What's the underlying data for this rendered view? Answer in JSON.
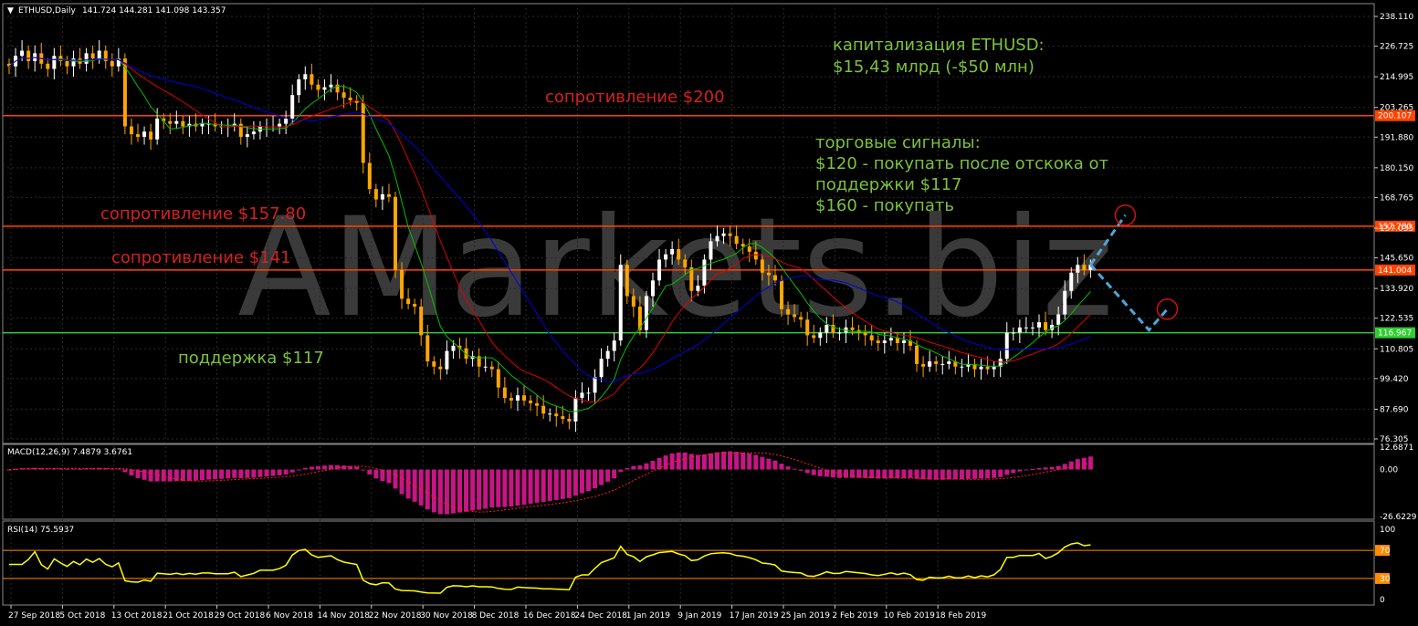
{
  "header": {
    "symbol": "ETHUSD,Daily",
    "ohlc": "141.724 144.281 141.098 143.357"
  },
  "watermark": "AMarkets.biz",
  "colors": {
    "bull": "#ffffff",
    "bear": "#ffa500",
    "grid": "#2a2a2a",
    "ma_fast": "#00c000",
    "ma_mid": "#e00000",
    "ma_slow": "#0000e0",
    "resistance": "#ff4500",
    "support": "#32cd32",
    "macd_hist": "#c71585",
    "macd_signal": "#ff2020",
    "rsi": "#ffff00",
    "rsi_level": "#ff8c00",
    "forecast": "#4ea5d9",
    "target_circle": "#d01010",
    "note_green": "#7cc23c",
    "note_red": "#d42020"
  },
  "annotations": {
    "cap_line1": "капитализация ETHUSD:",
    "cap_line2": "$15,43 млрд (-$50 млн)",
    "signals_line1": "торговые сигналы:",
    "signals_line2": "$120 - покупать после отскока от",
    "signals_line3": "поддержки $117",
    "signals_line4": "$160 - покупать",
    "res200": "сопротивление $200",
    "res157": "сопротивление $157.80",
    "res141": "сопротивление $141",
    "sup117": "поддержка $117"
  },
  "chart_data": [
    {
      "type": "candlestick",
      "name": "ETHUSD,Daily",
      "yticks": [
        "238.110",
        "226.725",
        "214.995",
        "203.265",
        "191.880",
        "180.150",
        "168.765",
        "157.035",
        "145.650",
        "133.920",
        "122.535",
        "110.805",
        "99.420",
        "87.690",
        "76.305"
      ],
      "ylim": [
        76.305,
        238.11
      ],
      "x_labels": [
        "27 Sep 2018",
        "5 Oct 2018",
        "13 Oct 2018",
        "21 Oct 2018",
        "29 Oct 2018",
        "6 Nov 2018",
        "14 Nov 2018",
        "22 Nov 2018",
        "30 Nov 2018",
        "8 Dec 2018",
        "16 Dec 2018",
        "24 Dec 2018",
        "1 Jan 2019",
        "9 Jan 2019",
        "17 Jan 2019",
        "25 Jan 2019",
        "2 Feb 2019",
        "10 Feb 2019",
        "18 Feb 2019"
      ],
      "levels": [
        {
          "value": 200.107,
          "label": "200.107",
          "kind": "resistance"
        },
        {
          "value": 157.78,
          "label": "157.780",
          "kind": "resistance"
        },
        {
          "value": 141.004,
          "label": "141.004",
          "kind": "resistance"
        },
        {
          "value": 116.967,
          "label": "116.967",
          "kind": "support"
        }
      ],
      "close": [
        219,
        223,
        225,
        221,
        224,
        220,
        218,
        223,
        221,
        219,
        222,
        220,
        224,
        222,
        225,
        221,
        219,
        222,
        196,
        193,
        192,
        194,
        191,
        199,
        198,
        197,
        198,
        196,
        197,
        196,
        197,
        197,
        196,
        196,
        196,
        197,
        192,
        193,
        194,
        196,
        196,
        196,
        197,
        199,
        208,
        214,
        216,
        212,
        210,
        211,
        212,
        209,
        207,
        206,
        205,
        182,
        172,
        168,
        170,
        169,
        141,
        130,
        128,
        127,
        116,
        106,
        104,
        103,
        110,
        112,
        111,
        107,
        108,
        104,
        104,
        103,
        96,
        92,
        91,
        93,
        91,
        90,
        89,
        86,
        86,
        85,
        84,
        83,
        92,
        94,
        94,
        100,
        107,
        110,
        114,
        143,
        131,
        127,
        118,
        131,
        137,
        145,
        147,
        149,
        145,
        142,
        133,
        135,
        145,
        152,
        154,
        155,
        154,
        151,
        150,
        148,
        145,
        140,
        139,
        137,
        126,
        124,
        123,
        122,
        116,
        115,
        117,
        120,
        117,
        117,
        119,
        118,
        117,
        116,
        114,
        113,
        114,
        115,
        113,
        114,
        112,
        105,
        104,
        106,
        105,
        105,
        106,
        104,
        104,
        105,
        103,
        104,
        103,
        104,
        107,
        117,
        117,
        119,
        119,
        119,
        121,
        118,
        120,
        124,
        133,
        140,
        143,
        141,
        143
      ]
    },
    {
      "type": "bar",
      "name": "MACD(12,26,9) 7.4879 3.6761",
      "yticks": [
        "12.6871",
        "0.00",
        "-26.6229"
      ],
      "ylim": [
        -26.6229,
        12.6871
      ]
    },
    {
      "type": "line",
      "name": "RSI(14) 75.5937",
      "yticks": [
        "100",
        "70",
        "30",
        "0"
      ],
      "ylim": [
        0,
        100
      ],
      "levels": [
        70,
        30
      ]
    }
  ]
}
